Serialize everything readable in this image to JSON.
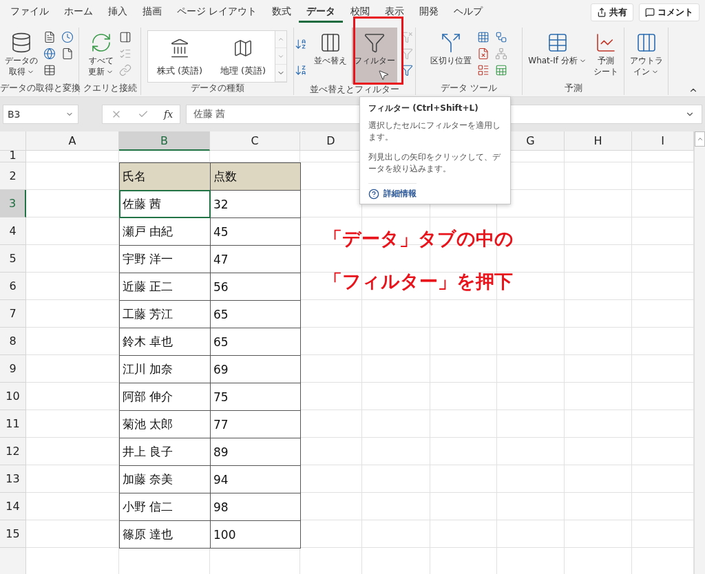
{
  "menu_tabs": [
    {
      "label": "ファイル",
      "selected": false
    },
    {
      "label": "ホーム",
      "selected": false
    },
    {
      "label": "挿入",
      "selected": false
    },
    {
      "label": "描画",
      "selected": false
    },
    {
      "label": "ページ レイアウト",
      "selected": false
    },
    {
      "label": "数式",
      "selected": false
    },
    {
      "label": "データ",
      "selected": true
    },
    {
      "label": "校閲",
      "selected": false
    },
    {
      "label": "表示",
      "selected": false
    },
    {
      "label": "開発",
      "selected": false
    },
    {
      "label": "ヘルプ",
      "selected": false
    }
  ],
  "header_buttons": [
    {
      "kind": "share",
      "label": "共有"
    },
    {
      "kind": "comment",
      "label": "コメント"
    }
  ],
  "ribbon_groups": [
    {
      "label": "データの取得と変換",
      "buttons": [
        {
          "lines": [
            "データの",
            "取得"
          ],
          "dropdown": true,
          "pressed": false
        }
      ]
    },
    {
      "label": "クエリと接続",
      "buttons": [
        {
          "lines": [
            "すべて",
            "更新"
          ],
          "dropdown": true,
          "pressed": false
        }
      ]
    },
    {
      "label": "データの種類",
      "buttons": [
        {
          "lines": [
            "株式 (英語)"
          ]
        },
        {
          "lines": [
            "地理 (英語)"
          ]
        }
      ]
    },
    {
      "label": "並べ替えとフィルター",
      "buttons": [
        {
          "lines": [
            "並べ替え"
          ],
          "dropdown": false,
          "pressed": false
        },
        {
          "lines": [
            "フィルター"
          ],
          "dropdown": false,
          "pressed": true
        }
      ]
    },
    {
      "label": "データ ツール",
      "buttons": [
        {
          "lines": [
            "区切り位置"
          ],
          "dropdown": false,
          "pressed": false
        }
      ]
    },
    {
      "label": "予測",
      "buttons": [
        {
          "lines": [
            "What-If 分析"
          ],
          "dropdown": true,
          "pressed": false
        },
        {
          "lines": [
            "予測",
            "シート"
          ],
          "dropdown": false,
          "pressed": false
        }
      ]
    },
    {
      "buttons": [
        {
          "lines": [
            "アウトラ",
            "イン"
          ],
          "dropdown": true,
          "pressed": false
        }
      ]
    }
  ],
  "formula_bar": {
    "name_box": "B3",
    "function_label": "fx",
    "value": "佐藤 茜"
  },
  "columns": [
    {
      "label": "A",
      "selected": false
    },
    {
      "label": "B",
      "selected": true
    },
    {
      "label": "C",
      "selected": false
    },
    {
      "label": "D",
      "selected": false
    },
    {
      "label": "G",
      "selected": false
    },
    {
      "label": "H",
      "selected": false
    },
    {
      "label": "I",
      "selected": false
    }
  ],
  "rows": [
    {
      "number": "1",
      "selected": false,
      "cells": []
    },
    {
      "number": "2",
      "selected": false,
      "cells": [
        {
          "text": "氏名",
          "active": false,
          "header": true
        },
        {
          "text": "点数",
          "active": false,
          "header": true
        }
      ]
    },
    {
      "number": "3",
      "selected": true,
      "cells": [
        {
          "text": "佐藤 茜",
          "active": true,
          "header": false
        },
        {
          "text": "32",
          "active": false,
          "header": false
        }
      ]
    },
    {
      "number": "4",
      "selected": false,
      "cells": [
        {
          "text": "瀬戸 由紀",
          "active": false,
          "header": false
        },
        {
          "text": "45",
          "active": false,
          "header": false
        }
      ]
    },
    {
      "number": "5",
      "selected": false,
      "cells": [
        {
          "text": "宇野 洋一",
          "active": false,
          "header": false
        },
        {
          "text": "47",
          "active": false,
          "header": false
        }
      ]
    },
    {
      "number": "6",
      "selected": false,
      "cells": [
        {
          "text": "近藤 正二",
          "active": false,
          "header": false
        },
        {
          "text": "56",
          "active": false,
          "header": false
        }
      ]
    },
    {
      "number": "7",
      "selected": false,
      "cells": [
        {
          "text": "工藤 芳江",
          "active": false,
          "header": false
        },
        {
          "text": "65",
          "active": false,
          "header": false
        }
      ]
    },
    {
      "number": "8",
      "selected": false,
      "cells": [
        {
          "text": "鈴木 卓也",
          "active": false,
          "header": false
        },
        {
          "text": "65",
          "active": false,
          "header": false
        }
      ]
    },
    {
      "number": "9",
      "selected": false,
      "cells": [
        {
          "text": "江川 加奈",
          "active": false,
          "header": false
        },
        {
          "text": "69",
          "active": false,
          "header": false
        }
      ]
    },
    {
      "number": "10",
      "selected": false,
      "cells": [
        {
          "text": "阿部 伸介",
          "active": false,
          "header": false
        },
        {
          "text": "75",
          "active": false,
          "header": false
        }
      ]
    },
    {
      "number": "11",
      "selected": false,
      "cells": [
        {
          "text": "菊池 太郎",
          "active": false,
          "header": false
        },
        {
          "text": "77",
          "active": false,
          "header": false
        }
      ]
    },
    {
      "number": "12",
      "selected": false,
      "cells": [
        {
          "text": "井上 良子",
          "active": false,
          "header": false
        },
        {
          "text": "89",
          "active": false,
          "header": false
        }
      ]
    },
    {
      "number": "13",
      "selected": false,
      "cells": [
        {
          "text": "加藤 奈美",
          "active": false,
          "header": false
        },
        {
          "text": "94",
          "active": false,
          "header": false
        }
      ]
    },
    {
      "number": "14",
      "selected": false,
      "cells": [
        {
          "text": "小野 信二",
          "active": false,
          "header": false
        },
        {
          "text": "98",
          "active": false,
          "header": false
        }
      ]
    },
    {
      "number": "15",
      "selected": false,
      "cells": [
        {
          "text": "篠原 達也",
          "active": false,
          "header": false
        },
        {
          "text": "100",
          "active": false,
          "header": false
        }
      ]
    }
  ],
  "tooltip": {
    "title": "フィルター (Ctrl+Shift+L)",
    "paragraphs": [
      "選択したセルにフィルターを適用します。",
      "列見出しの矢印をクリックして、データを絞り込みます。"
    ],
    "link": "詳細情報"
  },
  "annotation": {
    "lines": [
      "「データ」タブの中の",
      "「フィルター」を押下"
    ]
  }
}
